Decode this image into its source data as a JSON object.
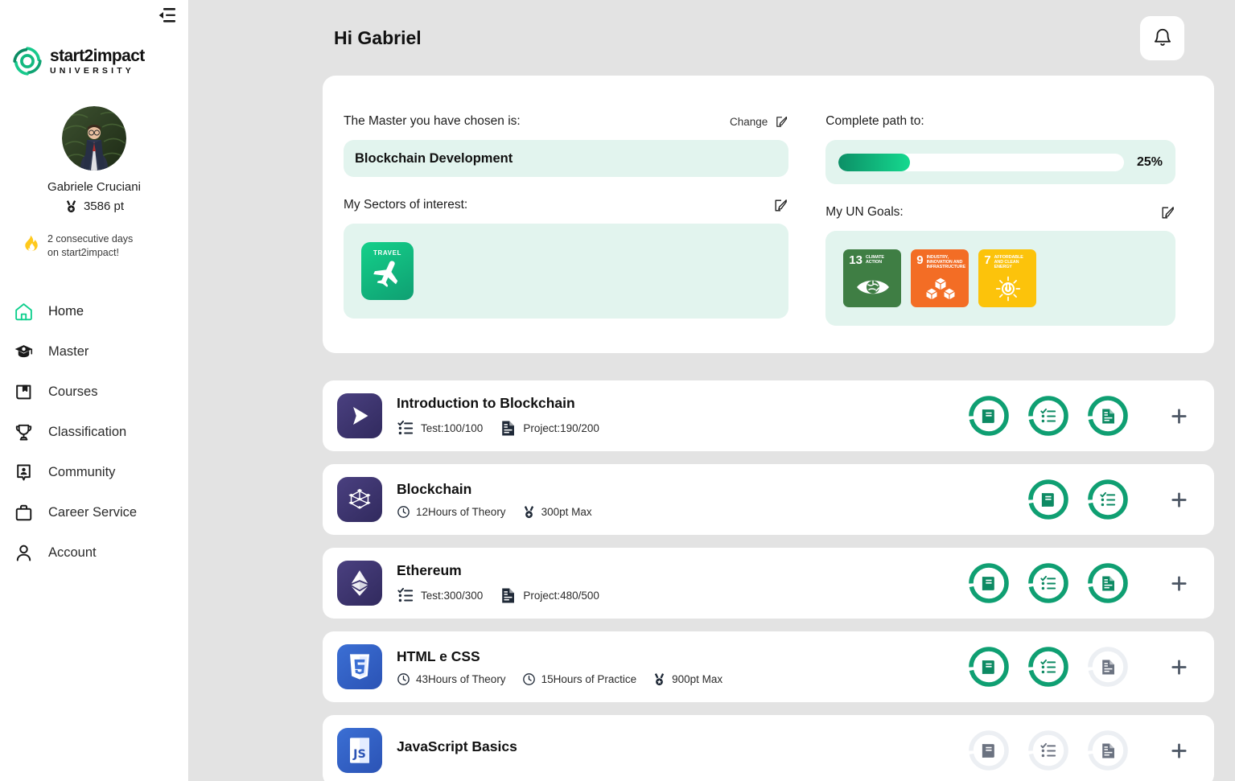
{
  "sidebar": {
    "collapse_icon": "collapse-sidebar-icon",
    "logo": {
      "name": "start2impact",
      "subtitle": "UNIVERSITY",
      "icon": "start2impact-logo-icon"
    },
    "profile": {
      "avatar_icon": "user-avatar",
      "name": "Gabriele Cruciani",
      "points": "3586 pt",
      "points_icon": "medal-icon"
    },
    "streak": {
      "icon": "flame-icon",
      "line1": "2 consecutive days",
      "line2": "on start2impact!"
    },
    "items": [
      {
        "label": "Home",
        "icon": "home-icon",
        "active": true
      },
      {
        "label": "Master",
        "icon": "graduation-cap-icon",
        "active": false
      },
      {
        "label": "Courses",
        "icon": "book-bookmark-icon",
        "active": false
      },
      {
        "label": "Classification",
        "icon": "trophy-icon",
        "active": false
      },
      {
        "label": "Community",
        "icon": "community-icon",
        "active": false
      },
      {
        "label": "Career Service",
        "icon": "briefcase-icon",
        "active": false
      },
      {
        "label": "Account",
        "icon": "person-icon",
        "active": false
      }
    ]
  },
  "header": {
    "greeting": "Hi Gabriel",
    "bell_icon": "notification-bell-icon"
  },
  "summary": {
    "master_label": "The Master you have chosen is:",
    "change_label": "Change",
    "change_icon": "edit-pencil-icon",
    "master_name": "Blockchain Development",
    "sectors_label": "My Sectors of interest:",
    "sectors_edit_icon": "edit-pencil-icon",
    "sectors": [
      {
        "name": "TRAVEL",
        "icon": "airplane-icon"
      }
    ],
    "path_label": "Complete path to:",
    "progress_percent": "25%",
    "progress_value": 25,
    "goals_label": "My UN Goals:",
    "goals_edit_icon": "edit-pencil-icon",
    "goals": [
      {
        "number": "13",
        "title": "Climate Action",
        "color": "#3f7e44",
        "art": "eye-earth-icon"
      },
      {
        "number": "9",
        "title": "Industry, Innovation and Infrastructure",
        "color": "#f36d25",
        "art": "cubes-icon"
      },
      {
        "number": "7",
        "title": "Affordable and Clean Energy",
        "color": "#fcc30b",
        "art": "sun-power-icon"
      }
    ]
  },
  "courses": [
    {
      "title": "Introduction to Blockchain",
      "thumb_icon": "play-icon",
      "thumb_style": "purple",
      "meta": [
        {
          "icon": "checklist-icon",
          "text": "Test:100/100"
        },
        {
          "icon": "document-icon",
          "text": "Project:190/200"
        }
      ],
      "actions": [
        {
          "icon": "book-icon",
          "state": "complete"
        },
        {
          "icon": "checklist-icon",
          "state": "complete"
        },
        {
          "icon": "document-icon",
          "state": "complete"
        }
      ],
      "add_icon": "plus-icon"
    },
    {
      "title": "Blockchain",
      "thumb_icon": "blockchain-nodes-icon",
      "thumb_style": "purple",
      "meta": [
        {
          "icon": "clock-icon",
          "text": "12Hours of Theory"
        },
        {
          "icon": "medal-icon",
          "text": "300pt Max"
        }
      ],
      "actions": [
        {
          "icon": "book-icon",
          "state": "complete"
        },
        {
          "icon": "checklist-icon",
          "state": "complete"
        }
      ],
      "add_icon": "plus-icon"
    },
    {
      "title": "Ethereum",
      "thumb_icon": "ethereum-icon",
      "thumb_style": "purple",
      "meta": [
        {
          "icon": "checklist-icon",
          "text": "Test:300/300"
        },
        {
          "icon": "document-icon",
          "text": "Project:480/500"
        }
      ],
      "actions": [
        {
          "icon": "book-icon",
          "state": "complete"
        },
        {
          "icon": "checklist-icon",
          "state": "complete"
        },
        {
          "icon": "document-icon",
          "state": "complete"
        }
      ],
      "add_icon": "plus-icon"
    },
    {
      "title": "HTML e CSS",
      "thumb_icon": "html5-icon",
      "thumb_style": "blue",
      "meta": [
        {
          "icon": "clock-icon",
          "text": "43Hours of Theory"
        },
        {
          "icon": "clock-icon",
          "text": "15Hours of Practice"
        },
        {
          "icon": "medal-icon",
          "text": "900pt Max"
        }
      ],
      "actions": [
        {
          "icon": "book-icon",
          "state": "complete"
        },
        {
          "icon": "checklist-icon",
          "state": "complete"
        },
        {
          "icon": "document-icon",
          "state": "empty"
        }
      ],
      "add_icon": "plus-icon"
    },
    {
      "title": "JavaScript Basics",
      "thumb_icon": "javascript-icon",
      "thumb_style": "blue",
      "meta": [],
      "actions": [
        {
          "icon": "book-icon",
          "state": "empty"
        },
        {
          "icon": "checklist-icon",
          "state": "empty"
        },
        {
          "icon": "document-icon",
          "state": "empty"
        }
      ],
      "add_icon": "plus-icon"
    }
  ],
  "colors": {
    "accent_green": "#0f9f72",
    "mint": "#e2f4ee",
    "page_bg": "#e3e3e3",
    "purple_tile": "#312a5e",
    "blue_tile": "#2b53b5"
  }
}
